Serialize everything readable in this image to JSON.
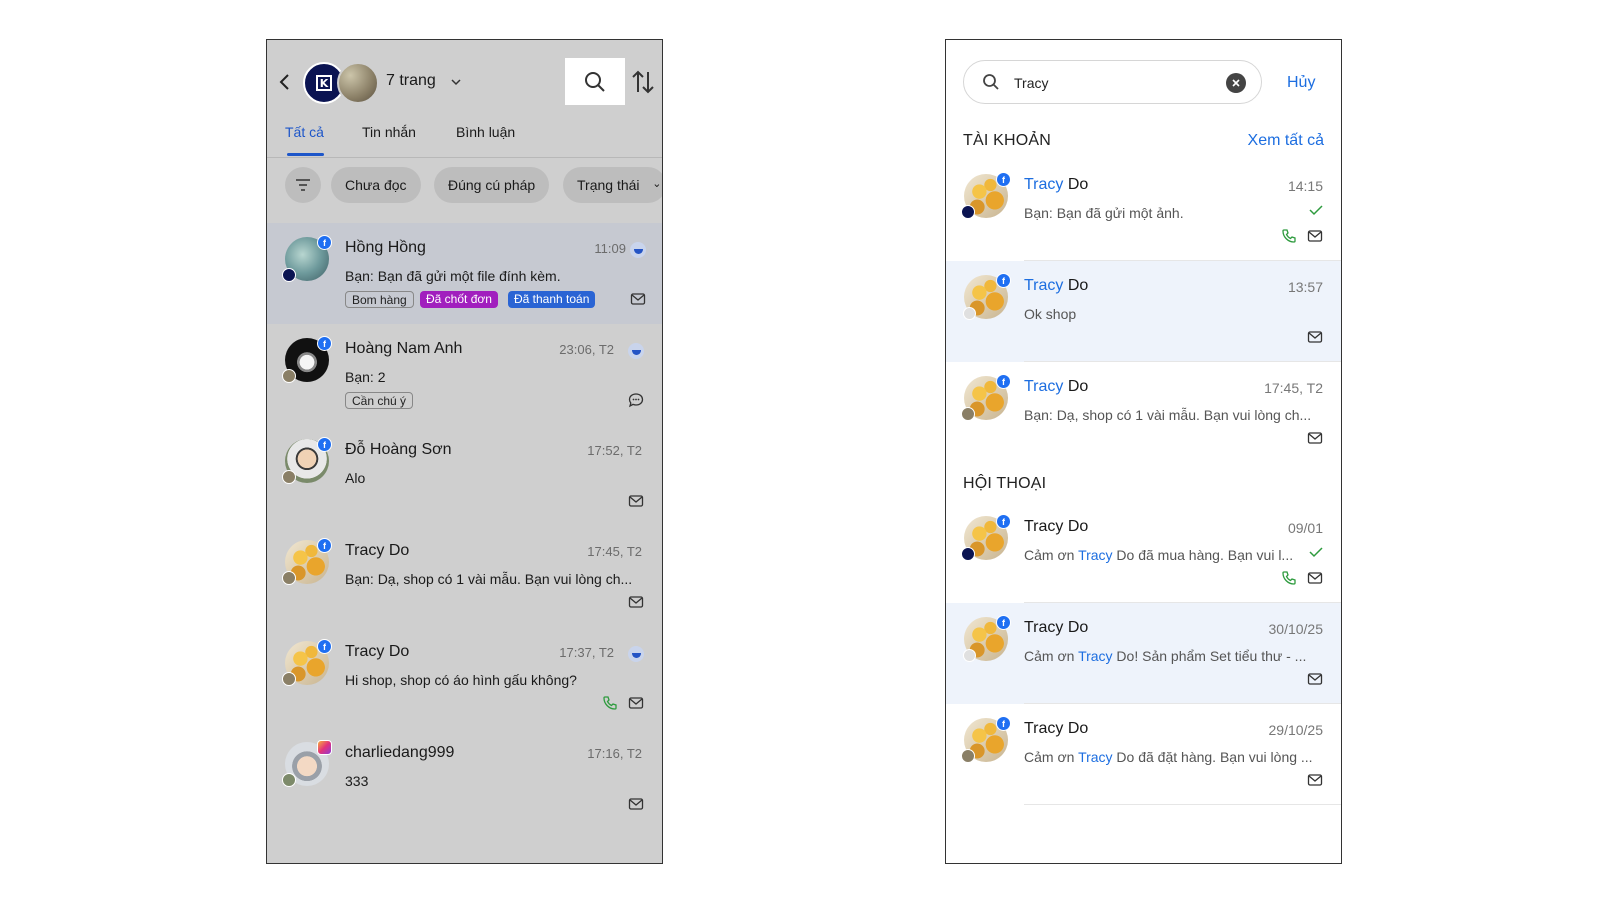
{
  "left": {
    "header": {
      "page_count_label": "7 trang",
      "brand_logo_letter": "K"
    },
    "tabs": [
      "Tất cả",
      "Tin nhắn",
      "Bình luận"
    ],
    "chips": [
      "Chưa đọc",
      "Đúng cú pháp",
      "Trạng thái"
    ],
    "conversations": [
      {
        "name": "Hồng Hồng",
        "time": "11:09",
        "message": "Bạn: Bạn đã gửi một file đính kèm.",
        "tags": [
          "Bom hàng",
          "Đã chốt đơn",
          "Đã thanh toán"
        ]
      },
      {
        "name": "Hoàng Nam Anh",
        "time": "23:06, T2",
        "message": "Bạn: 2",
        "tags": [
          "Cần chú ý"
        ]
      },
      {
        "name": "Đỗ Hoàng Sơn",
        "time": "17:52, T2",
        "message": "Alo"
      },
      {
        "name": "Tracy Do",
        "time": "17:45, T2",
        "message": "Bạn: Dạ, shop có 1 vài mẫu. Bạn vui lòng ch..."
      },
      {
        "name": "Tracy Do",
        "time": "17:37, T2",
        "message": "Hi shop, shop có áo hình gấu không?"
      },
      {
        "name": "charliedang999",
        "time": "17:16, T2",
        "message": "333"
      }
    ]
  },
  "right": {
    "search": {
      "query": "Tracy",
      "cancel_label": "Hủy"
    },
    "accounts_section": {
      "title": "TÀI KHOẢN",
      "see_all": "Xem tất cả"
    },
    "accounts": [
      {
        "name_hit": "Tracy",
        "name_rest": " Do",
        "time": "14:15",
        "message": "Bạn: Bạn đã gửi một ảnh."
      },
      {
        "name_hit": "Tracy",
        "name_rest": " Do",
        "time": "13:57",
        "message": "Ok shop"
      },
      {
        "name_hit": "Tracy",
        "name_rest": " Do",
        "time": "17:45, T2",
        "message": "Bạn: Dạ, shop có 1 vài mẫu. Bạn vui lòng ch..."
      }
    ],
    "conversations_section": {
      "title": "HỘI THOẠI"
    },
    "conversations": [
      {
        "name": "Tracy Do",
        "time": "09/01",
        "msg_pre": "Cảm ơn ",
        "msg_hit": "Tracy",
        "msg_post": " Do đã mua hàng. Bạn vui l..."
      },
      {
        "name": "Tracy Do",
        "time": "30/10/25",
        "msg_pre": "Cảm ơn ",
        "msg_hit": "Tracy",
        "msg_post": " Do! Sản phẩm Set tiểu thư - ..."
      },
      {
        "name": "Tracy Do",
        "time": "29/10/25",
        "msg_pre": "Cảm ơn ",
        "msg_hit": "Tracy",
        "msg_post": " Do đã đặt hàng. Bạn vui lòng ..."
      }
    ]
  },
  "colors": {
    "accent": "#1d6ee0",
    "tab_active": "#1d56c9",
    "tag_purple": "#a11fbe",
    "tag_blue": "#2a64d4",
    "call_green": "#2e9b3e",
    "left_bg": "#cfcfcf"
  },
  "icons": [
    "back-chevron-icon",
    "search-icon",
    "sort-icon",
    "filter-icon",
    "mail-icon",
    "comment-icon",
    "phone-icon",
    "check-icon",
    "clear-icon",
    "facebook-icon",
    "instagram-icon"
  ]
}
